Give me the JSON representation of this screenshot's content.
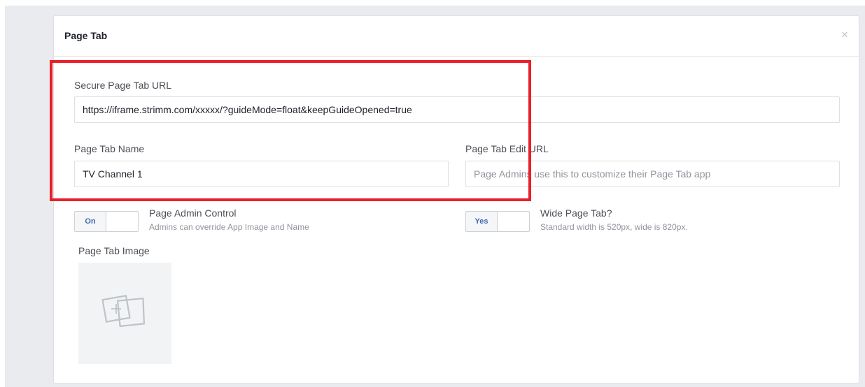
{
  "dialog": {
    "title": "Page Tab",
    "close_glyph": "×"
  },
  "secure_url": {
    "label": "Secure Page Tab URL",
    "value": "https://iframe.strimm.com/xxxxx/?guideMode=float&keepGuideOpened=true"
  },
  "tab_name": {
    "label": "Page Tab Name",
    "value": "TV Channel 1"
  },
  "edit_url": {
    "label": "Page Tab Edit URL",
    "value": "",
    "placeholder": "Page Admins use this to customize their Page Tab app"
  },
  "admin_control": {
    "state_label": "On",
    "title": "Page Admin Control",
    "description": "Admins can override App Image and Name"
  },
  "wide_tab": {
    "state_label": "Yes",
    "title": "Wide Page Tab?",
    "description": "Standard width is 520px, wide is 820px."
  },
  "tab_image": {
    "label": "Page Tab Image",
    "icon": "add-image-icon"
  },
  "colors": {
    "accent": "#4267b2",
    "highlight": "#e8202a",
    "label_text": "#4b4f56",
    "muted_text": "#90949c"
  }
}
